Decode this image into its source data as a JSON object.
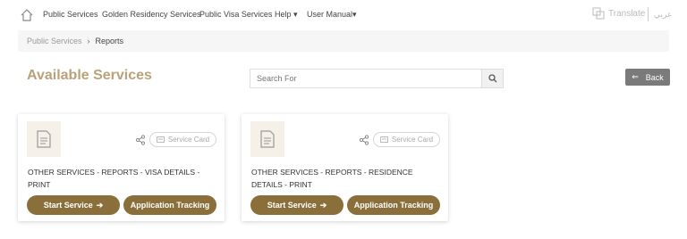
{
  "nav": {
    "items": [
      "Public Services",
      "Golden Residency Services",
      "Public Visa Services",
      "Help",
      "User Manual"
    ],
    "translate_label": "Translate",
    "arabic_label": "عربي"
  },
  "breadcrumb": [
    "Public Services",
    "Reports"
  ],
  "page": {
    "title": "Available Services"
  },
  "search": {
    "placeholder": "Search For"
  },
  "back_label": "Back",
  "cards": [
    {
      "service_card_label": "Service Card",
      "text": "OTHER SERVICES - REPORTS - VISA DETAILS - PRINT",
      "start_label": "Start Service",
      "tracking_label": "Application Tracking"
    },
    {
      "service_card_label": "Service Card",
      "text": "OTHER SERVICES - REPORTS - RESIDENCE DETAILS - PRINT",
      "start_label": "Start Service",
      "tracking_label": "Application Tracking"
    }
  ],
  "colors": {
    "accent": "#8b6f3b",
    "title": "#b9a27a",
    "back": "#7a7a7a"
  }
}
